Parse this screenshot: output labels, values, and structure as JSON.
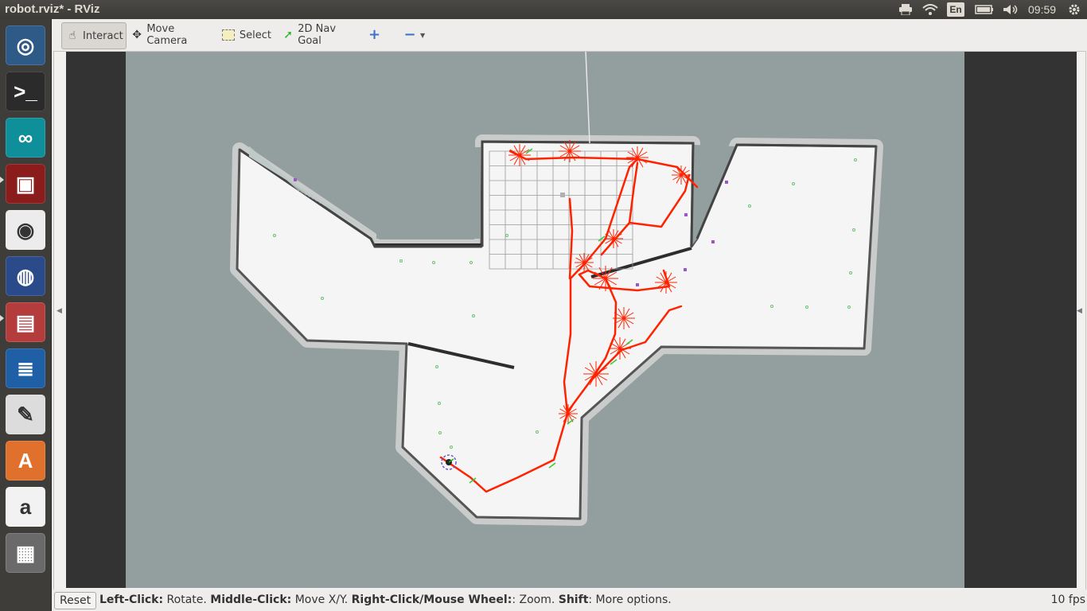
{
  "window": {
    "title": "robot.rviz* - RViz"
  },
  "panel": {
    "keyboard_layout": "En",
    "clock": "09:59"
  },
  "launcher": {
    "items": [
      {
        "name": "dash-home-icon",
        "bg": "#2d5a86"
      },
      {
        "name": "terminal-icon",
        "bg": "#2b2b2b"
      },
      {
        "name": "arduino-icon",
        "bg": "#0f8f9a"
      },
      {
        "name": "workspaces-icon",
        "bg": "#8a1c1c"
      },
      {
        "name": "chrome-icon",
        "bg": "#ececec"
      },
      {
        "name": "firefox-icon",
        "bg": "#2b4a8a"
      },
      {
        "name": "files-icon",
        "bg": "#b53c3c"
      },
      {
        "name": "writer-icon",
        "bg": "#1f5fa6"
      },
      {
        "name": "text-editor-icon",
        "bg": "#dcdcdc"
      },
      {
        "name": "software-center-icon",
        "bg": "#e0712c"
      },
      {
        "name": "amazon-icon",
        "bg": "#f2f2f2"
      },
      {
        "name": "trash-icon",
        "bg": "#6a6a6a"
      }
    ]
  },
  "toolbar": {
    "interact": "Interact",
    "move_camera": "Move Camera",
    "select": "Select",
    "nav_goal": "2D Nav Goal"
  },
  "status": {
    "reset": "Reset",
    "hint_left_click_key": "Left-Click:",
    "hint_left_click_val": " Rotate. ",
    "hint_middle_click_key": "Middle-Click:",
    "hint_middle_click_val": " Move X/Y. ",
    "hint_right_click_key": "Right-Click/Mouse Wheel:",
    "hint_right_click_val": ": Zoom. ",
    "hint_shift_key": "Shift",
    "hint_shift_val": ": More options.",
    "fps": "10 fps"
  },
  "colors": {
    "map_free": "#f5f5f5",
    "map_unknown": "#939f9e",
    "map_wall": "#2d2d2d",
    "trajectory": "#ff2200",
    "panel_bg": "#3c3b37"
  }
}
